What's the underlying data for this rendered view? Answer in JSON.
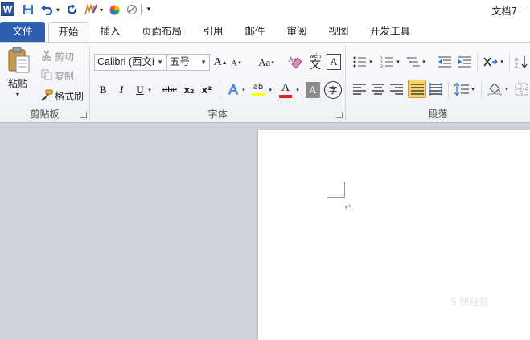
{
  "window": {
    "title": "文档7",
    "title_dash": "-"
  },
  "tabs": [
    "文件",
    "开始",
    "插入",
    "页面布局",
    "引用",
    "邮件",
    "审阅",
    "视图",
    "开发工具"
  ],
  "clipboard": {
    "paste": "粘贴",
    "cut": "剪切",
    "copy": "复制",
    "format_painter": "格式刷",
    "group_label": "剪贴板"
  },
  "font": {
    "name": "Calibri (西文i",
    "size": "五号",
    "grow": "A",
    "shrink": "A",
    "case": "Aa",
    "phonetic_top": "wén",
    "phonetic_char": "文",
    "border_char": "A",
    "bold": "B",
    "italic": "I",
    "underline": "U",
    "strike": "abc",
    "subscript": "x₂",
    "superscript": "x²",
    "text_effect": "A",
    "highlight": "ab",
    "font_color": "A",
    "shading": "A",
    "enclose": "字",
    "group_label": "字体"
  },
  "paragraph": {
    "group_label": "段落"
  },
  "document": {
    "para_mark": "↵",
    "watermark": "S 快经验"
  },
  "colors": {
    "file_tab": "#2c5eb0",
    "highlight": "#ffff00",
    "font_color": "#e02020",
    "active_align": "#fbd46d"
  }
}
